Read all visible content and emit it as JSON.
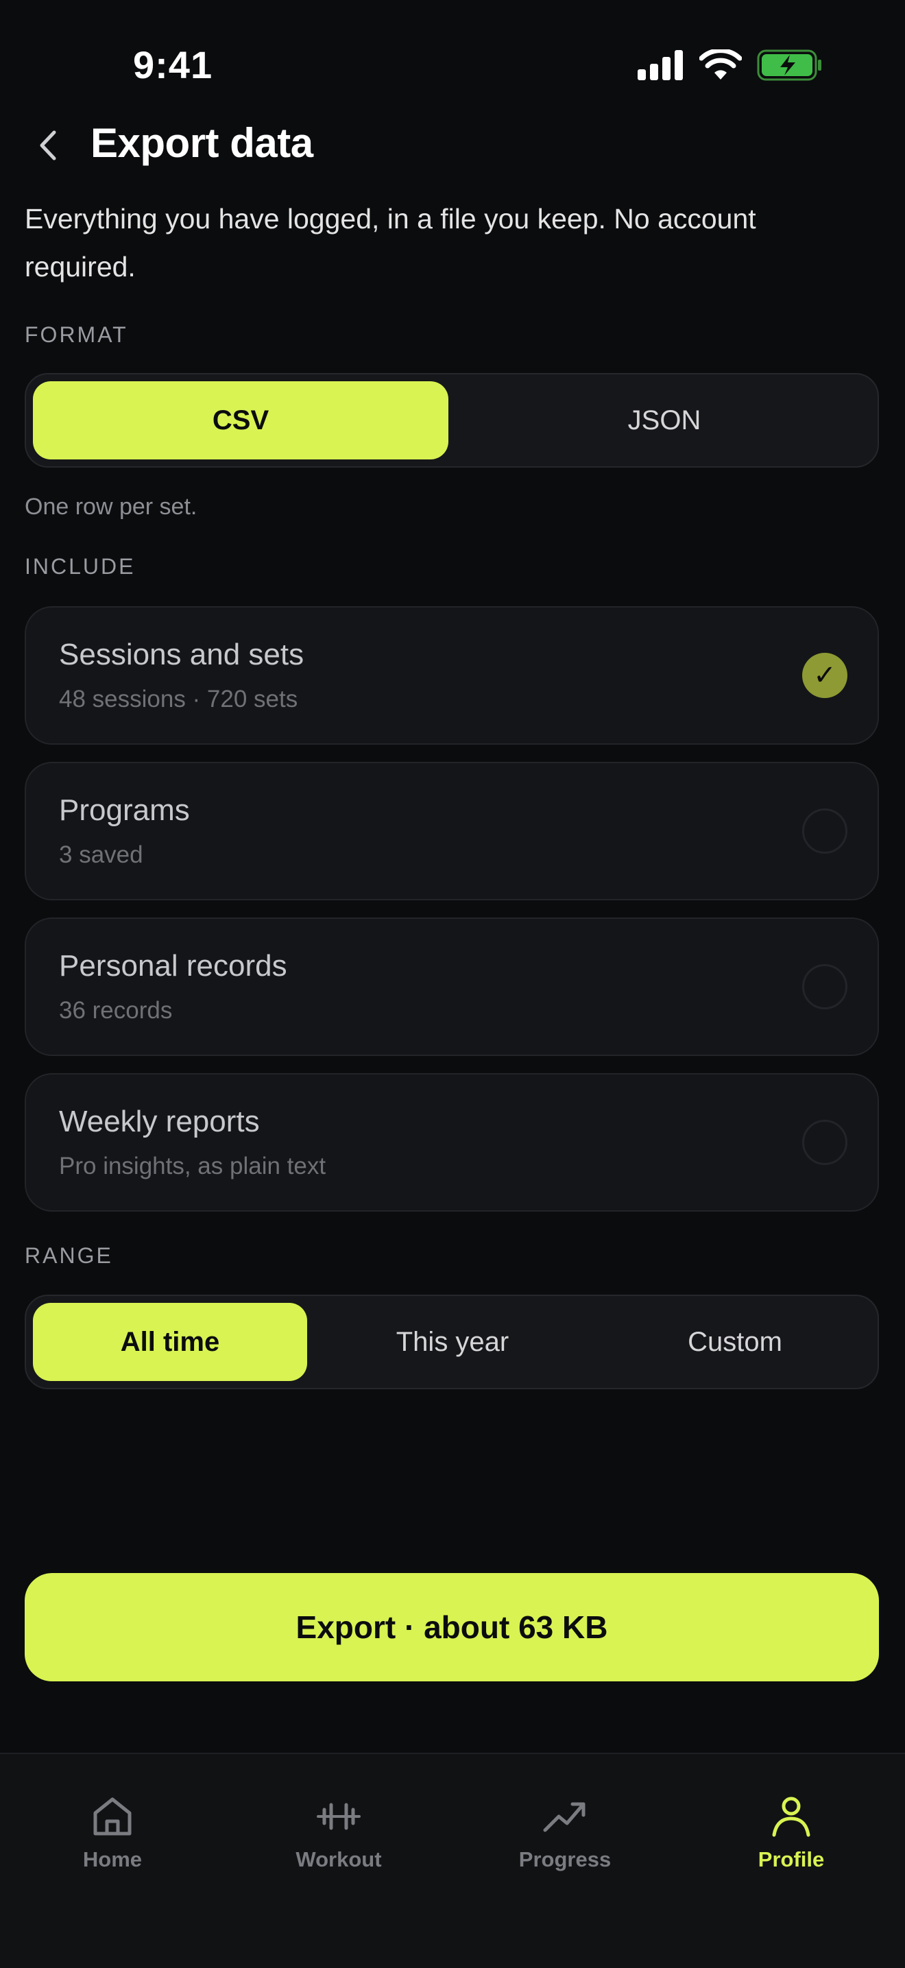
{
  "status_bar": {
    "time": "9:41"
  },
  "header": {
    "title": "Export data"
  },
  "intro": "Everything you have logged, in a file you keep. No account required.",
  "format": {
    "label": "FORMAT",
    "options": [
      {
        "label": "CSV",
        "active": true
      },
      {
        "label": "JSON",
        "active": false
      }
    ],
    "hint": "One row per set."
  },
  "include": {
    "label": "INCLUDE",
    "items": [
      {
        "title": "Sessions and sets",
        "subtitle": "48 sessions · 720 sets",
        "checked": true,
        "check_glyph": "✓"
      },
      {
        "title": "Programs",
        "subtitle": "3 saved",
        "checked": false
      },
      {
        "title": "Personal records",
        "subtitle": "36 records",
        "checked": false
      },
      {
        "title": "Weekly reports",
        "subtitle": "Pro insights, as plain text",
        "checked": false
      }
    ]
  },
  "range": {
    "label": "RANGE",
    "options": [
      {
        "label": "All time",
        "active": true
      },
      {
        "label": "This year",
        "active": false
      },
      {
        "label": "Custom",
        "active": false
      }
    ]
  },
  "export_button": {
    "label": "Export · about 63 KB"
  },
  "tabbar": {
    "items": [
      {
        "label": "Home",
        "icon": "home-icon",
        "active": false
      },
      {
        "label": "Workout",
        "icon": "dumbbell-icon",
        "active": false
      },
      {
        "label": "Progress",
        "icon": "trend-up-icon",
        "active": false
      },
      {
        "label": "Profile",
        "icon": "person-icon",
        "active": true
      }
    ]
  },
  "colors": {
    "accent": "#d8f352",
    "background": "#0b0c0e",
    "card": "#141518",
    "check_on": "#8e9a33"
  }
}
